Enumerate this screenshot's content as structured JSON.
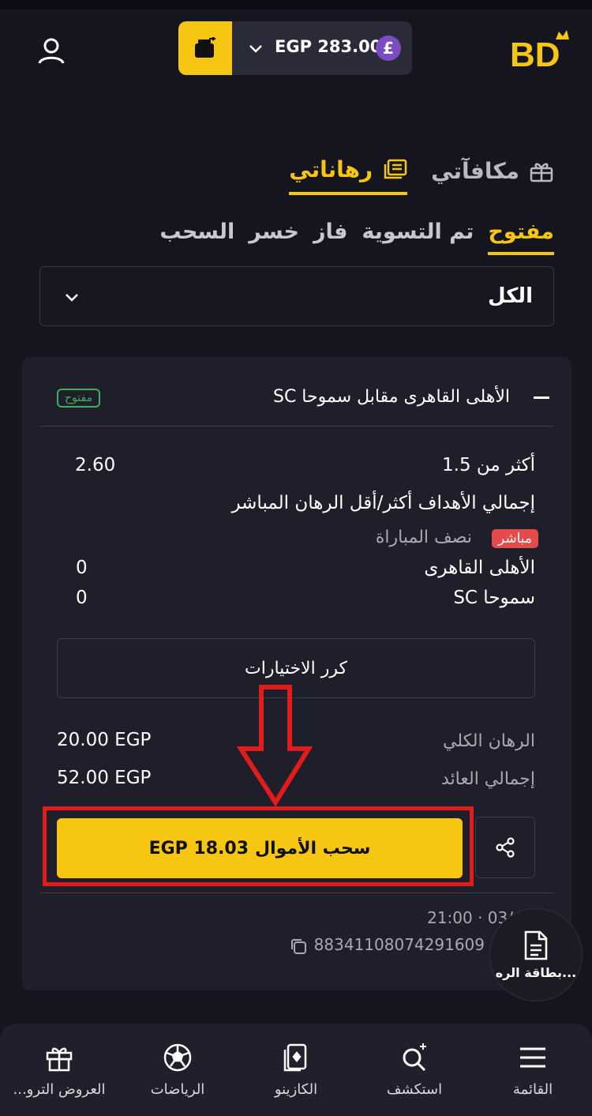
{
  "header": {
    "balance": "EGP 283.00",
    "currency_symbol": "£",
    "logo_text": "BD"
  },
  "main_tabs": [
    {
      "label": "رهاناتي",
      "icon": "tickets-icon",
      "active": true
    },
    {
      "label": "مكافآتي",
      "icon": "gift-box-icon",
      "active": false
    }
  ],
  "status_tabs": [
    "مفتوح",
    "تم التسوية",
    "فاز",
    "خسر",
    "السحب"
  ],
  "filter": {
    "value": "الكل"
  },
  "bet": {
    "match": "الأهلى القاهرى مقابل سموحا SC",
    "status_badge": "مفتوح",
    "selection": "أكثر من 1.5",
    "odds": "2.60",
    "market": "إجمالي الأهداف أكثر/أقل الرهان المباشر",
    "live_badge": "مباشر",
    "period": "نصف المباراة",
    "team1": "الأهلى القاهرى",
    "team1_score": "0",
    "team2": "سموحا SC",
    "team2_score": "0",
    "repeat_label": "كرر الاختيارات",
    "total_stake_label": "الرهان الكلي",
    "total_stake": "20.00 EGP",
    "total_return_label": "إجمالي العائد",
    "total_return": "52.00 EGP",
    "cashout_label": "سحب الأموال",
    "cashout_amount": "EGP 18.03",
    "time": "21:00 · 03/",
    "ticket_id": "88341108074291609"
  },
  "floating_button": {
    "label": "بطاقة الره..."
  },
  "bottom_nav": [
    {
      "label": "القائمة",
      "icon": "menu-icon"
    },
    {
      "label": "استكشف",
      "icon": "explore-search-icon"
    },
    {
      "label": "الكازينو",
      "icon": "cards-icon"
    },
    {
      "label": "الرياضات",
      "icon": "soccer-ball-icon"
    },
    {
      "label": "العروض الترو...",
      "icon": "gift-icon"
    }
  ],
  "colors": {
    "accent": "#f7c612",
    "background": "#15151f",
    "card": "#1f1f2b",
    "open_badge": "#3fae5d",
    "live_badge": "#e54b4b",
    "annotation": "#e31b1b"
  }
}
